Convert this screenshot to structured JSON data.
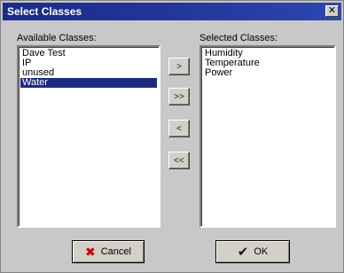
{
  "window": {
    "title": "Select Classes",
    "close_glyph": "✕"
  },
  "available": {
    "label": "Available Classes:",
    "items": [
      "Dave Test",
      "IP",
      "unused",
      "Water"
    ],
    "selected_index": 3
  },
  "selected": {
    "label": "Selected Classes:",
    "items": [
      "Humidity",
      "Temperature",
      "Power"
    ]
  },
  "move_buttons": {
    "add_one": ">",
    "add_all": ">>",
    "remove_one": "<",
    "remove_all": "<<"
  },
  "actions": {
    "cancel": "Cancel",
    "ok": "OK"
  },
  "icons": {
    "cancel": "x-icon",
    "ok": "check-icon",
    "close": "close-icon"
  }
}
